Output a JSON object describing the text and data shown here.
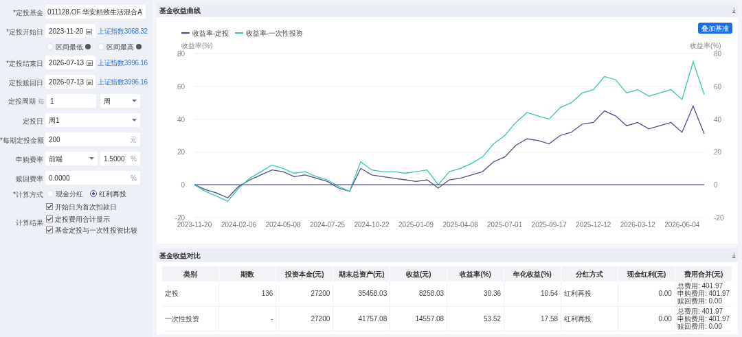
{
  "form": {
    "rows": [
      {
        "kind": "text",
        "label": "*定投基金",
        "value": "011128.OF 华安精致生活混合A"
      },
      {
        "kind": "date",
        "label": "*定投开始日",
        "value": "2023-11-20",
        "note": "上证指数3068.32"
      },
      {
        "kind": "radios",
        "options": [
          {
            "label": "区间最低",
            "selected": false,
            "help": true
          },
          {
            "label": "区间最高",
            "selected": false,
            "help": true
          }
        ]
      },
      {
        "kind": "date",
        "label": "*定投结束日",
        "value": "2026-07-13",
        "note": "上证指数3996.16"
      },
      {
        "kind": "date",
        "label": "定投赎回日",
        "value": "2026-07-13",
        "note": "上证指数3996.16"
      },
      {
        "kind": "period",
        "label": "定投周期",
        "prefix": "每",
        "value": "1",
        "select": "周"
      },
      {
        "kind": "select",
        "label": "定投日",
        "value": "周1"
      },
      {
        "kind": "unit",
        "label": "*每期定投金额",
        "value": "200",
        "unit": "元"
      },
      {
        "kind": "fee",
        "label": "申购费率",
        "select": "前端",
        "value": "1.5000",
        "unit": "%"
      },
      {
        "kind": "unit",
        "label": "赎回费率",
        "value": "0.0000",
        "unit": "%"
      },
      {
        "kind": "radios",
        "label": "*计算方式",
        "options": [
          {
            "label": "现金分红",
            "selected": false
          },
          {
            "label": "红利再投",
            "selected": true
          }
        ]
      },
      {
        "kind": "checks",
        "options": [
          {
            "label": "开始日为首次扣款日",
            "checked": true
          }
        ]
      },
      {
        "kind": "checks",
        "label": "计算结果",
        "options": [
          {
            "label": "定投费用合计显示",
            "checked": true
          },
          {
            "label": "基金定投与一次性投资比较",
            "checked": true
          }
        ]
      }
    ]
  },
  "chart_panel": {
    "title": "基金收益曲线",
    "button": "叠加基准",
    "left_axis_title": "收益率(%)",
    "right_axis_title": "收益率(%)",
    "left_axis_ticks": [
      "80",
      "60",
      "40",
      "20",
      "0",
      "-20"
    ],
    "chart_data": {
      "type": "line",
      "categories": [
        "2023-11-20",
        null,
        null,
        null,
        "2024-02-06",
        null,
        null,
        null,
        "2024-05-08",
        null,
        null,
        null,
        "2024-07-25",
        null,
        null,
        null,
        "2024-10-22",
        null,
        null,
        null,
        "2025-01-09",
        null,
        null,
        null,
        "2025-04-08",
        null,
        null,
        null,
        "2025-07-01",
        null,
        null,
        null,
        "2025-09-17",
        null,
        null,
        null,
        "2025-12-12",
        null,
        null,
        null,
        "2026-03-12",
        null,
        null,
        null,
        "2026-06-04",
        null,
        null
      ],
      "series": [
        {
          "name": "收益率-定投",
          "color": "#4b4f86",
          "values": [
            0,
            -3,
            -5,
            -8,
            -1,
            3,
            6,
            9,
            8,
            5,
            6,
            4,
            2,
            -2,
            -4,
            10,
            6,
            5,
            4,
            3,
            2,
            3,
            -2,
            3,
            4,
            6,
            8,
            14,
            17,
            24,
            28,
            27,
            25,
            30,
            32,
            37,
            38,
            45,
            42,
            36,
            38,
            34,
            36,
            38,
            32,
            48,
            31
          ]
        },
        {
          "name": "收益率-一次性投资",
          "color": "#3cc3b3",
          "values": [
            0,
            -4,
            -7,
            -10,
            -2,
            4,
            8,
            12,
            10,
            7,
            8,
            5,
            3,
            -1,
            -4,
            14,
            9,
            8,
            8,
            7,
            8,
            9,
            0,
            8,
            10,
            13,
            17,
            25,
            30,
            38,
            44,
            42,
            40,
            47,
            50,
            56,
            58,
            66,
            64,
            56,
            58,
            54,
            56,
            58,
            52,
            75,
            55
          ]
        }
      ],
      "ylim": [
        -20,
        80
      ],
      "grid": true,
      "legend": "top-left",
      "ref_lines": [
        {
          "axis": "y",
          "value": 0,
          "color": "#4b4f86"
        }
      ],
      "yticks": [
        -20,
        0,
        20,
        40,
        60,
        80
      ]
    },
    "download": "⤓"
  },
  "table_panel": {
    "title": "基金收益对比",
    "download": "⤓",
    "columns": [
      "类别",
      "期数",
      "投资本金(元)",
      "期末总资产(元)",
      "收益(元)",
      "收益率(%)",
      "年化收益(%)",
      "分红方式",
      "现金红利(元)",
      "费用合并(元)"
    ],
    "rows": [
      {
        "cells": [
          "定投",
          "136",
          "27200",
          "35458.03",
          "8258.03",
          "30.36",
          "10.54",
          "红利再投",
          "0.00"
        ],
        "fees": [
          "总费用: 401.97",
          "申购费用: 401.97",
          "赎回费用: 0.00"
        ]
      },
      {
        "cells": [
          "一次性投资",
          "-",
          "27200",
          "41757.08",
          "14557.08",
          "53.52",
          "17.58",
          "红利再投",
          "0.00"
        ],
        "fees": [
          "总费用: 401.97",
          "申购费用: 401.97",
          "赎回费用: 0.00"
        ]
      }
    ]
  }
}
